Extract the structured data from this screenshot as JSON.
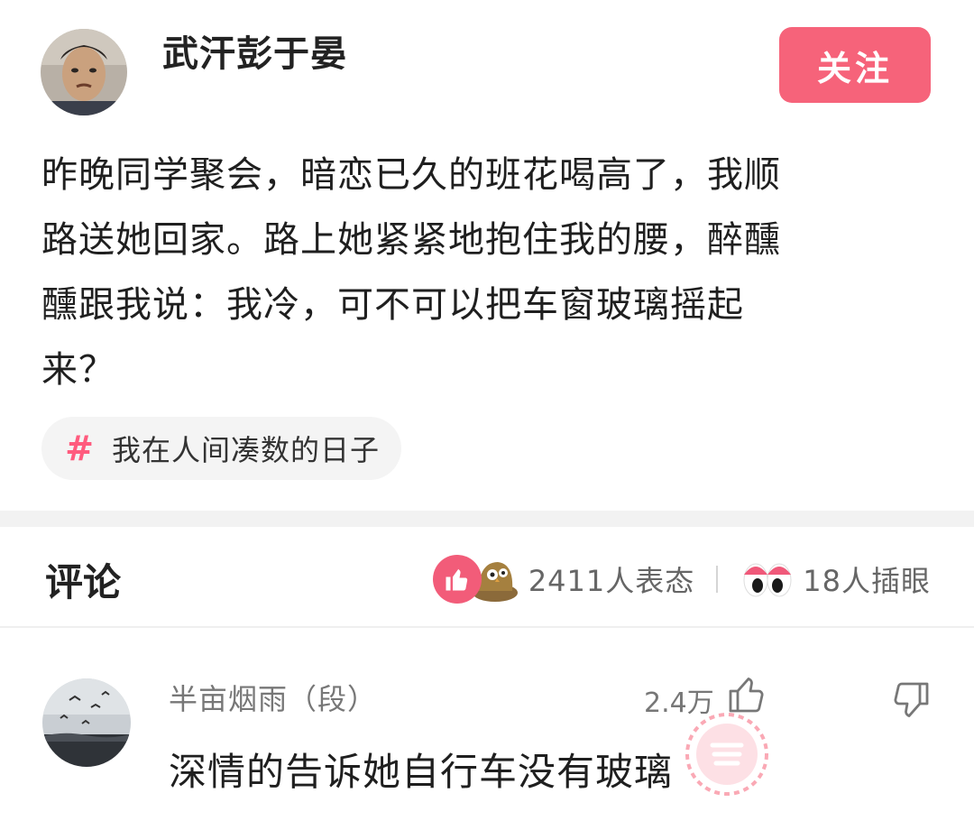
{
  "post": {
    "author_name": "武汗彭于晏",
    "follow_label": "关注",
    "body_lines": [
      "昨晚同学聚会，暗恋已久的班花喝高了，我顺",
      "路送她回家。路上她紧紧地抱住我的腰，醉醺",
      "醺跟我说：我冷，可不可以把车窗玻璃摇起",
      "来？"
    ],
    "topic": {
      "icon": "hash-icon",
      "label": "我在人间凑数的日子"
    }
  },
  "comments_section": {
    "title": "评论",
    "reactions": {
      "icons": [
        "thumbs-up-icon",
        "owl-icon"
      ],
      "count_text": "2411人表态"
    },
    "eyes": {
      "icon": "eyes-icon",
      "count_text": "18人插眼"
    }
  },
  "comment": {
    "username": "半亩烟雨（段）",
    "likes": "2.4万",
    "text": "深情的告诉她自行车没有玻璃"
  },
  "colors": {
    "accent": "#f6637a",
    "hash": "#ff5b7e",
    "like_bg": "#f25c79"
  }
}
